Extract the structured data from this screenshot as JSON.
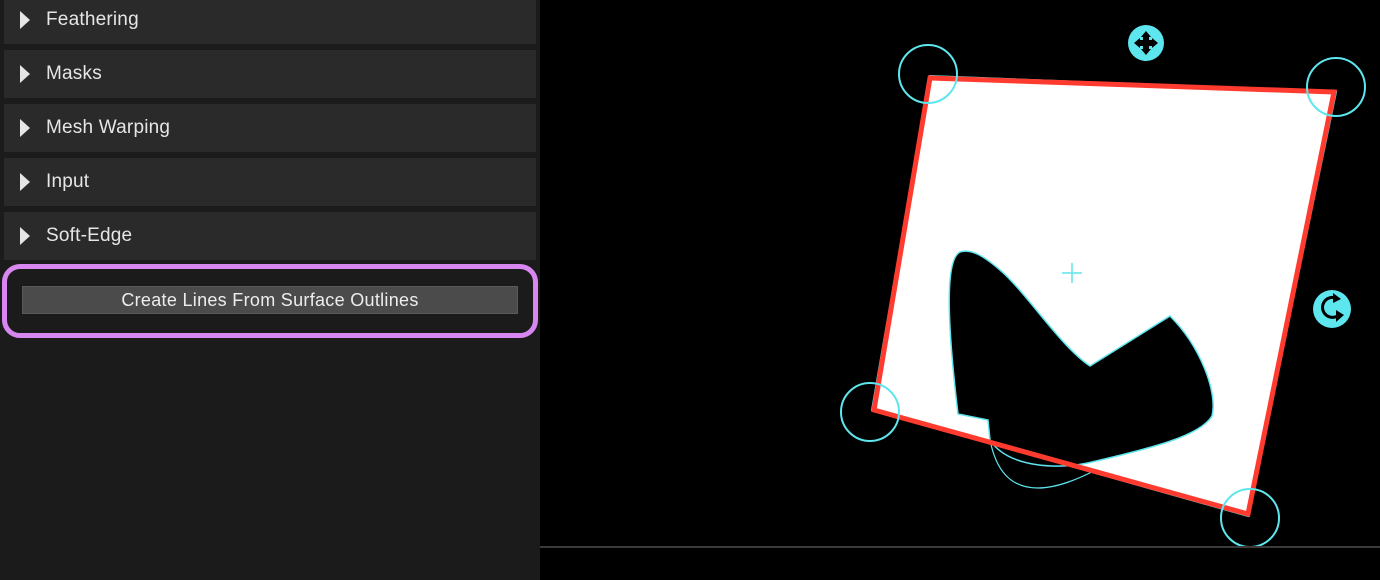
{
  "sections": [
    {
      "label": "Feathering"
    },
    {
      "label": "Masks"
    },
    {
      "label": "Mesh Warping"
    },
    {
      "label": "Input"
    },
    {
      "label": "Soft-Edge"
    }
  ],
  "create_lines_button": {
    "label": "Create Lines From Surface Outlines"
  },
  "colors": {
    "handle": "#5ee6ee",
    "surface_outline": "#ff3b2f",
    "highlight": "#d987f0"
  },
  "icons": {
    "move": "move-icon",
    "rotate": "rotate-icon",
    "center": "center-crosshair-icon"
  }
}
